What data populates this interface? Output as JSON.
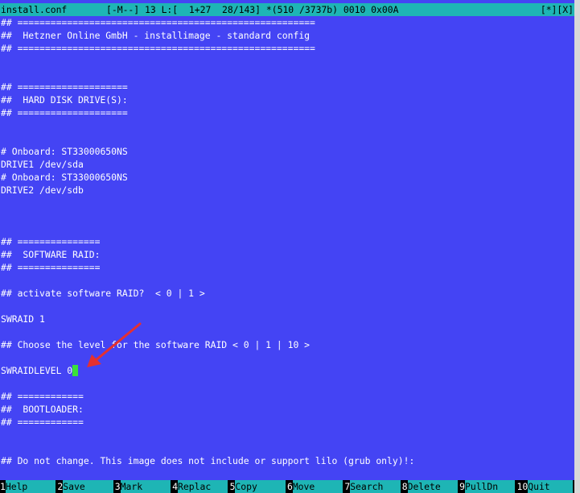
{
  "status_bar": {
    "filename": "install.conf",
    "info": "[-M--] 13 L:[  1+27  28/143] *(510 /3737b) 0010 0x00A",
    "flags": "[*][X]"
  },
  "editor": {
    "lines": [
      "## ======================================================",
      "##  Hetzner Online GmbH - installimage - standard config",
      "## ======================================================",
      "",
      "",
      "## ====================",
      "##  HARD DISK DRIVE(S):",
      "## ====================",
      "",
      "",
      "# Onboard: ST33000650NS",
      "DRIVE1 /dev/sda",
      "# Onboard: ST33000650NS",
      "DRIVE2 /dev/sdb",
      "",
      "",
      "",
      "## ===============",
      "##  SOFTWARE RAID:",
      "## ===============",
      "",
      "## activate software RAID?  < 0 | 1 >",
      "",
      "SWRAID 1",
      "",
      "## Choose the level for the software RAID < 0 | 1 | 10 >",
      "",
      "SWRAIDLEVEL 0",
      "",
      "## ============",
      "##  BOOTLOADER:",
      "## ============",
      "",
      "",
      "## Do not change. This image does not include or support lilo (grub only)!:"
    ]
  },
  "keybar": [
    {
      "num": "1",
      "label": "Help"
    },
    {
      "num": "2",
      "label": "Save"
    },
    {
      "num": "3",
      "label": "Mark"
    },
    {
      "num": "4",
      "label": "Replac"
    },
    {
      "num": "5",
      "label": "Copy"
    },
    {
      "num": "6",
      "label": "Move"
    },
    {
      "num": "7",
      "label": "Search"
    },
    {
      "num": "8",
      "label": "Delete"
    },
    {
      "num": "9",
      "label": "PullDn"
    },
    {
      "num": "10",
      "label": "Quit"
    }
  ],
  "colors": {
    "background": "#4444f4",
    "status_bar": "#1eb5b5",
    "cursor": "#3ae23a",
    "arrow": "#e53030"
  },
  "annotation": {
    "arrow_icon": "red-arrow-icon"
  }
}
